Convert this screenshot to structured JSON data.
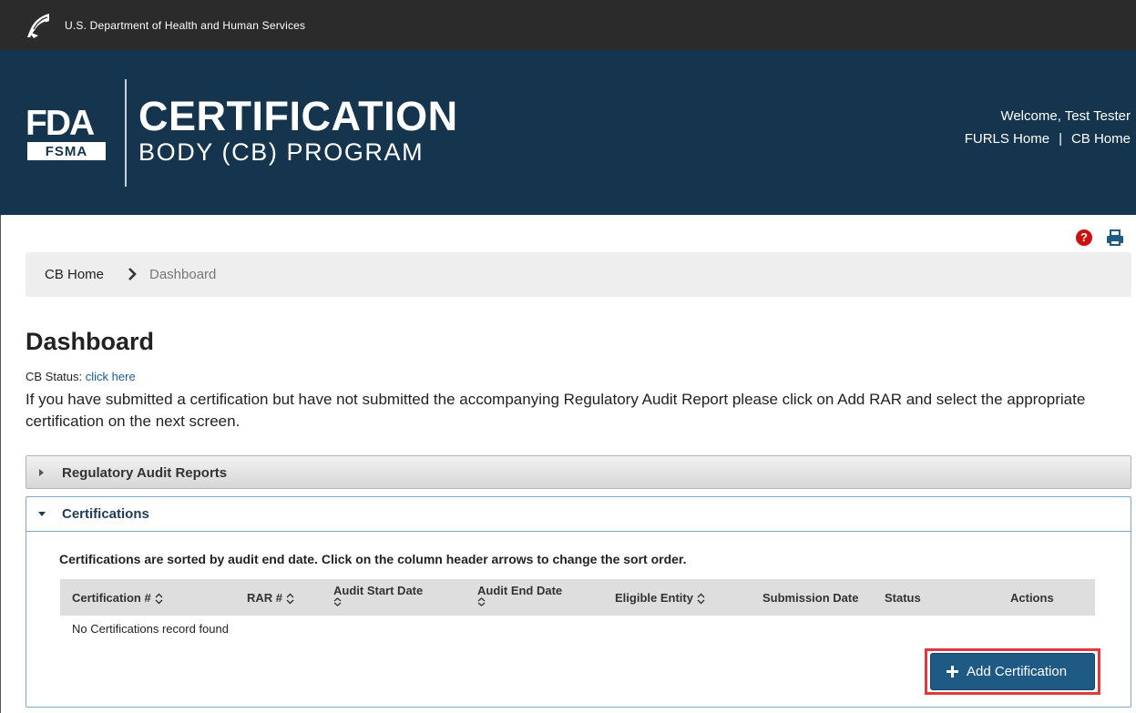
{
  "header": {
    "agency": "U.S. Department of Health and Human Services",
    "fda_logo_text": "FDA",
    "fsma_logo_text": "FSMA",
    "program_title_line1": "CERTIFICATION",
    "program_title_line2": "BODY (CB) PROGRAM",
    "welcome": "Welcome, Test Tester",
    "links": [
      "FURLS Home",
      "CB Home"
    ],
    "link_separator": "|"
  },
  "utility_icons": [
    "help-icon",
    "print-icon"
  ],
  "help_glyph": "?",
  "breadcrumb": {
    "home": "CB Home",
    "current": "Dashboard"
  },
  "main": {
    "title": "Dashboard",
    "cb_status_label": "CB Status:",
    "cb_status_link": "click here",
    "intro": "If you have submitted a certification but have not submitted the accompanying Regulatory Audit Report please click on Add RAR and select the appropriate certification on the next screen."
  },
  "accordions": {
    "rar": {
      "label": "Regulatory Audit Reports",
      "expanded": false
    },
    "certifications": {
      "label": "Certifications",
      "expanded": true,
      "sort_note": "Certifications are sorted by audit end date. Click on the column header arrows to change the sort order.",
      "columns": [
        "Certification #",
        "RAR #",
        "Audit Start Date",
        "Audit End Date",
        "Eligible Entity",
        "Submission Date",
        "Status",
        "Actions"
      ],
      "empty_message": "No Certifications record found",
      "add_button": "Add Certification"
    }
  },
  "colors": {
    "top_bar": "#2b2b2b",
    "banner": "#15354e",
    "primary_button": "#1f5a85",
    "highlight": "#e0393b",
    "help_red": "#cc1111",
    "link_blue": "#1a5aa3"
  }
}
